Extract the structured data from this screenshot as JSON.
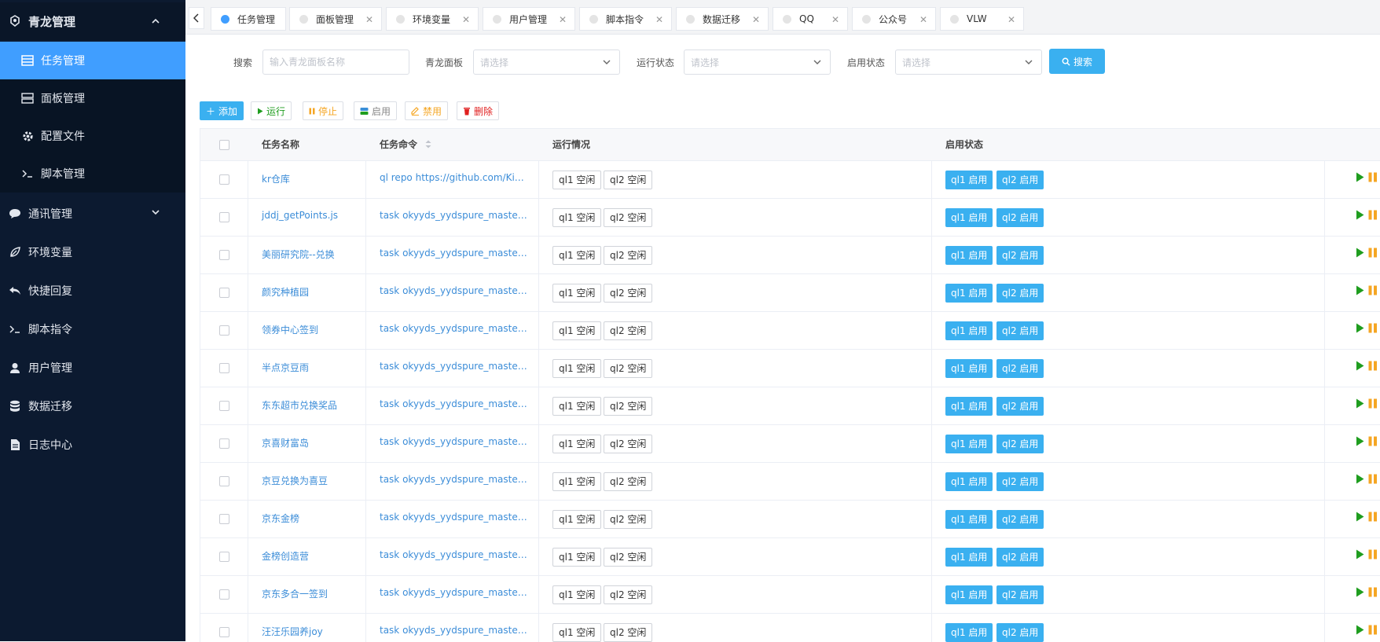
{
  "sidebar": {
    "app_title": "青龙管理",
    "items": [
      {
        "label": "任务管理",
        "icon": "list-icon",
        "active": true
      },
      {
        "label": "面板管理",
        "icon": "server-icon"
      },
      {
        "label": "配置文件",
        "icon": "gear-icon"
      },
      {
        "label": "脚本管理",
        "icon": "terminal-icon"
      }
    ],
    "groups": [
      {
        "label": "通讯管理",
        "icon": "chat-icon"
      },
      {
        "label": "环境变量",
        "icon": "leaf-icon"
      },
      {
        "label": "快捷回复",
        "icon": "reply-icon"
      },
      {
        "label": "脚本指令",
        "icon": "terminal-icon"
      },
      {
        "label": "用户管理",
        "icon": "user-icon"
      },
      {
        "label": "数据迁移",
        "icon": "database-icon"
      },
      {
        "label": "日志中心",
        "icon": "file-icon"
      }
    ]
  },
  "tabs": [
    {
      "label": "任务管理",
      "active": true
    },
    {
      "label": "面板管理"
    },
    {
      "label": "环境变量"
    },
    {
      "label": "用户管理"
    },
    {
      "label": "脚本指令"
    },
    {
      "label": "数据迁移"
    },
    {
      "label": "QQ"
    },
    {
      "label": "公众号"
    },
    {
      "label": "VLW"
    }
  ],
  "search": {
    "keyword_label": "搜索",
    "keyword_placeholder": "输入青龙面板名称",
    "panel_label": "青龙面板",
    "panel_placeholder": "请选择",
    "run_label": "运行状态",
    "run_placeholder": "请选择",
    "enable_label": "启用状态",
    "enable_placeholder": "请选择",
    "button": "搜索"
  },
  "actions": {
    "add": "添加",
    "run": "运行",
    "stop": "停止",
    "enable": "启用",
    "disable": "禁用",
    "delete": "删除"
  },
  "table": {
    "headers": {
      "name": "任务名称",
      "command": "任务命令",
      "run_status": "运行情况",
      "enable_status": "启用状态"
    },
    "status_tags": [
      "ql1 空闲",
      "ql2 空闲"
    ],
    "enable_tags": [
      "ql1 启用",
      "ql2 启用"
    ],
    "rows": [
      {
        "name": "kr仓库",
        "command": "ql repo https://github.com/KingRan/KR.git"
      },
      {
        "name": "jddj_getPoints.js",
        "command": "task okyyds_yydspure_master_jddj_getPoints.js"
      },
      {
        "name": "美丽研究院--兑换",
        "command": "task okyyds_yydspure_master_jd_beauty_ex.js"
      },
      {
        "name": "颜究种植园",
        "command": "task okyyds_yydspure_master_jd_plantBean.js"
      },
      {
        "name": "领券中心签到",
        "command": "task okyyds_yydspure_master_jd_ccSign.js"
      },
      {
        "name": "半点京豆雨",
        "command": "task okyyds_yydspure_master_jd_half_redrain.js"
      },
      {
        "name": "东东超市兑换奖品",
        "command": "task okyyds_yydspure_master_jd_blueCoin.js"
      },
      {
        "name": "京喜财富岛",
        "command": "task okyyds_yydspure_master_jx_cfd.js"
      },
      {
        "name": "京豆兑换为喜豆",
        "command": "task okyyds_yydspure_master_jd_exchangejxbeans.js"
      },
      {
        "name": "京东金榜",
        "command": "task okyyds_yydspure_master_jd_gold_sign.js"
      },
      {
        "name": "金榜创造营",
        "command": "task okyyds_yydspure_master_jd_gold_creator.js"
      },
      {
        "name": "京东多合一签到",
        "command": "task okyyds_yydspure_master_jd_bean_sign.js"
      },
      {
        "name": "汪汪乐园养joy",
        "command": "task okyyds_yydspure_master_jd_joypark_joy.js"
      }
    ]
  },
  "colors": {
    "sidebar_bg": "#0c1a30",
    "active_blue": "#409eff",
    "primary": "#3ab0f0",
    "run_green": "#1f9d1f",
    "pause_orange": "#f5a623",
    "delete_red": "#e02020"
  }
}
